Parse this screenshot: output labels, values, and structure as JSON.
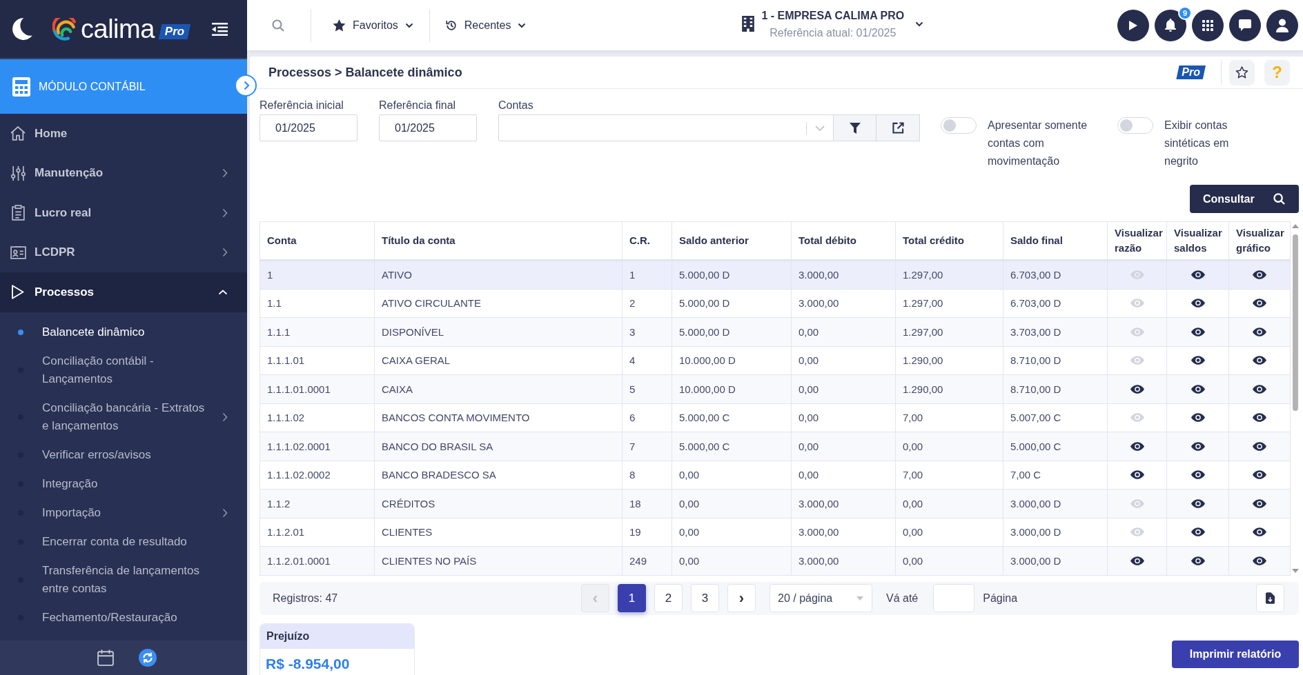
{
  "sidebar": {
    "logo": {
      "name": "calima",
      "badge": "Pro"
    },
    "module": {
      "label": "MÓDULO CONTÁBIL"
    },
    "items": [
      {
        "label": "Home",
        "expandable": false,
        "expanded": false
      },
      {
        "label": "Manutenção",
        "expandable": true,
        "expanded": false
      },
      {
        "label": "Lucro real",
        "expandable": true,
        "expanded": false
      },
      {
        "label": "LCDPR",
        "expandable": true,
        "expanded": false
      },
      {
        "label": "Processos",
        "expandable": true,
        "expanded": true,
        "children": [
          {
            "label": "Balancete dinâmico",
            "selected": true,
            "expandable": false
          },
          {
            "label": "Conciliação contábil - Lançamentos",
            "selected": false,
            "expandable": false
          },
          {
            "label": "Conciliação bancária - Extratos e lançamentos",
            "selected": false,
            "expandable": true
          },
          {
            "label": "Verificar erros/avisos",
            "selected": false,
            "expandable": false
          },
          {
            "label": "Integração",
            "selected": false,
            "expandable": false
          },
          {
            "label": "Importação",
            "selected": false,
            "expandable": true
          },
          {
            "label": "Encerrar conta de resultado",
            "selected": false,
            "expandable": false
          },
          {
            "label": "Transferência de lançamentos entre contas",
            "selected": false,
            "expandable": false
          },
          {
            "label": "Fechamento/Restauração",
            "selected": false,
            "expandable": false
          }
        ]
      }
    ]
  },
  "topbar": {
    "favorites": {
      "label": "Favoritos"
    },
    "recents": {
      "label": "Recentes"
    },
    "company": {
      "name": "1 - EMPRESA CALIMA PRO",
      "reference": "Referência atual: 01/2025"
    },
    "notifications": {
      "count": "9"
    }
  },
  "page": {
    "breadcrumb": "Processos > Balancete dinâmico",
    "badge": "Pro",
    "help": "?"
  },
  "filters": {
    "fields": [
      {
        "label": "Referência inicial",
        "value": "01/2025"
      },
      {
        "label": "Referência final",
        "value": "01/2025"
      }
    ],
    "accounts": {
      "label": "Contas"
    },
    "toggles": [
      {
        "label": "Apresentar somente contas com movimentação",
        "on": false
      },
      {
        "label": "Exibir contas sintéticas em negrito",
        "on": false
      }
    ],
    "submit": "Consultar"
  },
  "table": {
    "columns": [
      "Conta",
      "Título da conta",
      "C.R.",
      "Saldo anterior",
      "Total débito",
      "Total crédito",
      "Saldo final",
      "Visualizar razão",
      "Visualizar saldos",
      "Visualizar gráfico"
    ],
    "rows": [
      {
        "selected": true,
        "cells": [
          "1",
          "ATIVO",
          "1",
          "5.000,00 D",
          "3.000,00",
          "1.297,00",
          "6.703,00 D"
        ],
        "views": [
          {
            "enabled": false
          },
          {
            "enabled": true
          },
          {
            "enabled": true
          }
        ]
      },
      {
        "selected": false,
        "cells": [
          "1.1",
          "ATIVO CIRCULANTE",
          "2",
          "5.000,00 D",
          "3.000,00",
          "1.297,00",
          "6.703,00 D"
        ],
        "views": [
          {
            "enabled": false
          },
          {
            "enabled": true
          },
          {
            "enabled": true
          }
        ]
      },
      {
        "selected": false,
        "cells": [
          "1.1.1",
          "DISPONÍVEL",
          "3",
          "5.000,00 D",
          "0,00",
          "1.297,00",
          "3.703,00 D"
        ],
        "views": [
          {
            "enabled": false
          },
          {
            "enabled": true
          },
          {
            "enabled": true
          }
        ]
      },
      {
        "selected": false,
        "cells": [
          "1.1.1.01",
          "CAIXA GERAL",
          "4",
          "10.000,00 D",
          "0,00",
          "1.290,00",
          "8.710,00 D"
        ],
        "views": [
          {
            "enabled": false
          },
          {
            "enabled": true
          },
          {
            "enabled": true
          }
        ]
      },
      {
        "selected": false,
        "cells": [
          "1.1.1.01.0001",
          "CAIXA",
          "5",
          "10.000,00 D",
          "0,00",
          "1.290,00",
          "8.710,00 D"
        ],
        "views": [
          {
            "enabled": true
          },
          {
            "enabled": true
          },
          {
            "enabled": true
          }
        ]
      },
      {
        "selected": false,
        "cells": [
          "1.1.1.02",
          "BANCOS CONTA MOVIMENTO",
          "6",
          "5.000,00 C",
          "0,00",
          "7,00",
          "5.007,00 C"
        ],
        "views": [
          {
            "enabled": false
          },
          {
            "enabled": true
          },
          {
            "enabled": true
          }
        ]
      },
      {
        "selected": false,
        "cells": [
          "1.1.1.02.0001",
          "BANCO DO BRASIL SA",
          "7",
          "5.000,00 C",
          "0,00",
          "0,00",
          "5.000,00 C"
        ],
        "views": [
          {
            "enabled": true
          },
          {
            "enabled": true
          },
          {
            "enabled": true
          }
        ]
      },
      {
        "selected": false,
        "cells": [
          "1.1.1.02.0002",
          "BANCO BRADESCO SA",
          "8",
          "0,00",
          "0,00",
          "7,00",
          "7,00 C"
        ],
        "views": [
          {
            "enabled": true
          },
          {
            "enabled": true
          },
          {
            "enabled": true
          }
        ]
      },
      {
        "selected": false,
        "cells": [
          "1.1.2",
          "CRÉDITOS",
          "18",
          "0,00",
          "3.000,00",
          "0,00",
          "3.000,00 D"
        ],
        "views": [
          {
            "enabled": false
          },
          {
            "enabled": true
          },
          {
            "enabled": true
          }
        ]
      },
      {
        "selected": false,
        "cells": [
          "1.1.2.01",
          "CLIENTES",
          "19",
          "0,00",
          "3.000,00",
          "0,00",
          "3.000,00 D"
        ],
        "views": [
          {
            "enabled": false
          },
          {
            "enabled": true
          },
          {
            "enabled": true
          }
        ]
      },
      {
        "selected": false,
        "cells": [
          "1.1.2.01.0001",
          "CLIENTES NO PAÍS",
          "249",
          "0,00",
          "3.000,00",
          "0,00",
          "3.000,00 D"
        ],
        "views": [
          {
            "enabled": true
          },
          {
            "enabled": true
          },
          {
            "enabled": true
          }
        ]
      }
    ]
  },
  "pagination": {
    "records": "Registros: 47",
    "prev": {
      "label": "‹",
      "disabled": true
    },
    "pages": [
      {
        "label": "1",
        "selected": true
      },
      {
        "label": "2",
        "selected": false
      },
      {
        "label": "3",
        "selected": false
      }
    ],
    "next": {
      "label": "›",
      "disabled": false
    },
    "page_size": "20 / página",
    "goto_label": "Vá até",
    "goto_suffix": "Página"
  },
  "summary": {
    "title": "Prejuízo",
    "value": "R$ -8.954,00"
  },
  "actions": {
    "print": "Imprimir relatório"
  }
}
